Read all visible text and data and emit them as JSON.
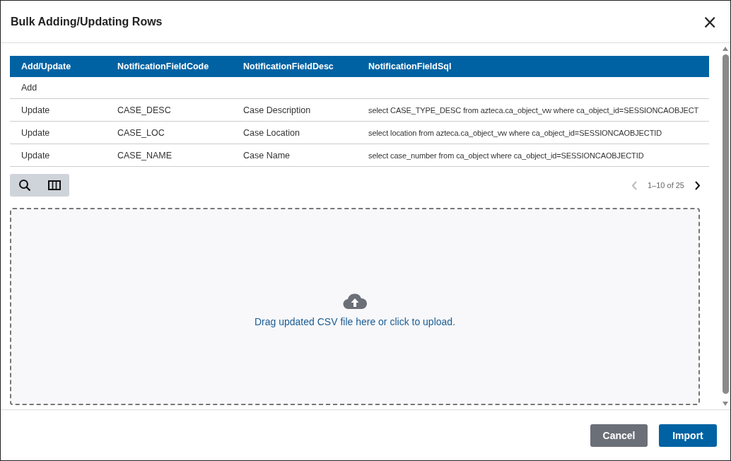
{
  "dialog": {
    "title": "Bulk Adding/Updating Rows",
    "close": "×"
  },
  "table": {
    "columns": [
      "Add/Update",
      "NotificationFieldCode",
      "NotificationFieldDesc",
      "NotificationFieldSql"
    ],
    "rows": [
      [
        "Add",
        "",
        "",
        ""
      ],
      [
        "Update",
        "CASE_DESC",
        "Case Description",
        "select CASE_TYPE_DESC from azteca.ca_object_vw where ca_object_id=SESSIONCAOBJECT"
      ],
      [
        "Update",
        "CASE_LOC",
        "Case Location",
        "select location from azteca.ca_object_vw where ca_object_id=SESSIONCAOBJECTID"
      ],
      [
        "Update",
        "CASE_NAME",
        "Case Name",
        "select case_number from ca_object where ca_object_id=SESSIONCAOBJECTID"
      ]
    ]
  },
  "pagination": {
    "range": "1–10 of 25",
    "prev_disabled": true,
    "next_disabled": false
  },
  "dropzone": {
    "text": "Drag updated CSV file here or click to upload."
  },
  "buttons": [
    {
      "label": "Cancel",
      "kind": "secondary"
    },
    {
      "label": "Import",
      "kind": "primary"
    }
  ]
}
